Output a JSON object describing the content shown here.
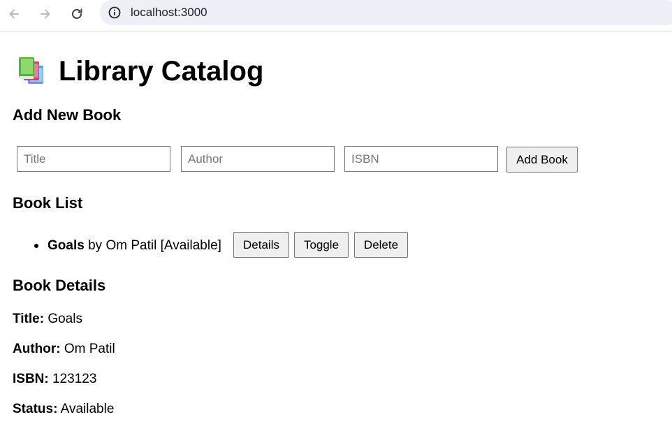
{
  "browser": {
    "url": "localhost:3000"
  },
  "page": {
    "title": "Library Catalog",
    "add_section_title": "Add New Book",
    "form": {
      "title_placeholder": "Title",
      "author_placeholder": "Author",
      "isbn_placeholder": "ISBN",
      "add_button": "Add Book"
    },
    "list_section_title": "Book List",
    "books": [
      {
        "title": "Goals",
        "by": "by",
        "author": "Om Patil",
        "status_text": "[Available]",
        "details_button": "Details",
        "toggle_button": "Toggle",
        "delete_button": "Delete"
      }
    ],
    "details_section_title": "Book Details",
    "details": {
      "title_label": "Title:",
      "title_value": "Goals",
      "author_label": "Author:",
      "author_value": "Om Patil",
      "isbn_label": "ISBN:",
      "isbn_value": "123123",
      "status_label": "Status:",
      "status_value": "Available"
    }
  },
  "icons": {
    "back": "back-arrow-icon",
    "forward": "forward-arrow-icon",
    "reload": "reload-icon",
    "site_info": "info-icon",
    "books": "books-icon"
  }
}
